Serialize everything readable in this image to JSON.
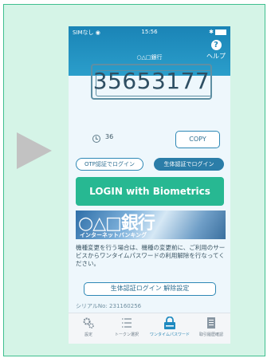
{
  "status_bar": {
    "carrier": "SIMなし",
    "time": "15:56",
    "bluetooth": "✱"
  },
  "header": {
    "title": "○△□銀行",
    "help_label": "ヘルプ"
  },
  "otp": {
    "code": "35653177",
    "timer": "36",
    "copy_label": "COPY"
  },
  "mode_tabs": {
    "otp_label": "OTP認証でログイン",
    "bio_label": "生体認証でログイン"
  },
  "login_button": "LOGIN with Biometrics",
  "banner": {
    "logo": "○△□銀行",
    "subtitle": "インターネットバンキング"
  },
  "info_text": "機種変更を行う場合は、機種の変更前に、ご利用のサービスからワンタイムパスワードの利用解除を行なってください。",
  "setting_button": "生体認証ログイン 解除設定",
  "serial": "シリアルNo: 231160256",
  "tabs": [
    {
      "label": "設定",
      "icon": "gear-icon"
    },
    {
      "label": "トークン選択",
      "icon": "list-icon"
    },
    {
      "label": "ワンタイムパスワード",
      "icon": "lock-icon"
    },
    {
      "label": "取引履歴確認",
      "icon": "document-icon"
    }
  ],
  "colors": {
    "accent": "#27b892",
    "brand": "#2b9ecb",
    "background": "#d5f4e7"
  }
}
